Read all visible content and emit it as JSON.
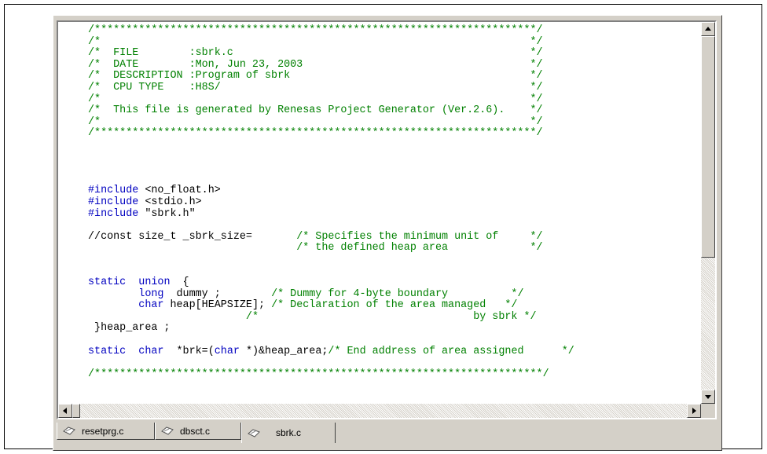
{
  "editor": {
    "lines": [
      [
        {
          "t": "/**********************************************************************/",
          "c": "c"
        }
      ],
      [
        {
          "t": "/*                                                                    */",
          "c": "c"
        }
      ],
      [
        {
          "t": "/*  FILE        :sbrk.c                                               */",
          "c": "c"
        }
      ],
      [
        {
          "t": "/*  DATE        :Mon, Jun 23, 2003                                    */",
          "c": "c"
        }
      ],
      [
        {
          "t": "/*  DESCRIPTION :Program of sbrk                                      */",
          "c": "c"
        }
      ],
      [
        {
          "t": "/*  CPU TYPE    :H8S/                                                 */",
          "c": "c"
        }
      ],
      [
        {
          "t": "/*                                                                    */",
          "c": "c"
        }
      ],
      [
        {
          "t": "/*  This file is generated by Renesas Project Generator (Ver.2.6).    */",
          "c": "c"
        }
      ],
      [
        {
          "t": "/*                                                                    */",
          "c": "c"
        }
      ],
      [
        {
          "t": "/**********************************************************************/",
          "c": "c"
        }
      ],
      [],
      [],
      [],
      [],
      [
        {
          "t": "#include",
          "c": "p"
        },
        {
          "t": " <no_float.h>",
          "c": ""
        }
      ],
      [
        {
          "t": "#include",
          "c": "p"
        },
        {
          "t": " <stdio.h>",
          "c": ""
        }
      ],
      [
        {
          "t": "#include",
          "c": "p"
        },
        {
          "t": " \"sbrk.h\"",
          "c": ""
        }
      ],
      [],
      [
        {
          "t": "//const size_t _sbrk_size=       ",
          "c": ""
        },
        {
          "t": "/* Specifies the minimum unit of     */",
          "c": "c"
        }
      ],
      [
        {
          "t": "                                 ",
          "c": ""
        },
        {
          "t": "/* the defined heap area             */",
          "c": "c"
        }
      ],
      [],
      [],
      [
        {
          "t": "static",
          "c": "k"
        },
        {
          "t": "  ",
          "c": ""
        },
        {
          "t": "union",
          "c": "k"
        },
        {
          "t": "  {",
          "c": ""
        }
      ],
      [
        {
          "t": "        ",
          "c": ""
        },
        {
          "t": "long",
          "c": "k"
        },
        {
          "t": "  dummy ;        ",
          "c": ""
        },
        {
          "t": "/* Dummy for 4-byte boundary          */",
          "c": "c"
        }
      ],
      [
        {
          "t": "        ",
          "c": ""
        },
        {
          "t": "char",
          "c": "k"
        },
        {
          "t": " heap[HEAPSIZE]; ",
          "c": ""
        },
        {
          "t": "/* Declaration of the area managed   */",
          "c": "c"
        }
      ],
      [
        {
          "t": "                         ",
          "c": ""
        },
        {
          "t": "/*                                  by sbrk */",
          "c": "c"
        }
      ],
      [
        {
          "t": " }heap_area ;",
          "c": ""
        }
      ],
      [],
      [
        {
          "t": "static",
          "c": "k"
        },
        {
          "t": "  ",
          "c": ""
        },
        {
          "t": "char",
          "c": "k"
        },
        {
          "t": "  *brk=(",
          "c": ""
        },
        {
          "t": "char",
          "c": "k"
        },
        {
          "t": " *)&heap_area;",
          "c": ""
        },
        {
          "t": "/* End address of area assigned      */",
          "c": "c"
        }
      ],
      [],
      [
        {
          "t": "/***********************************************************************/",
          "c": "c"
        }
      ]
    ]
  },
  "tabs": [
    {
      "label": "resetprg.c",
      "icon": "c-file-icon",
      "active": false
    },
    {
      "label": "dbsct.c",
      "icon": "c-file-icon",
      "active": false
    },
    {
      "label": "sbrk.c",
      "icon": "c-file-icon",
      "active": true
    }
  ],
  "colors": {
    "comment": "#008000",
    "keyword": "#0000c0",
    "text": "#000000",
    "chrome": "#d4d0c8"
  }
}
